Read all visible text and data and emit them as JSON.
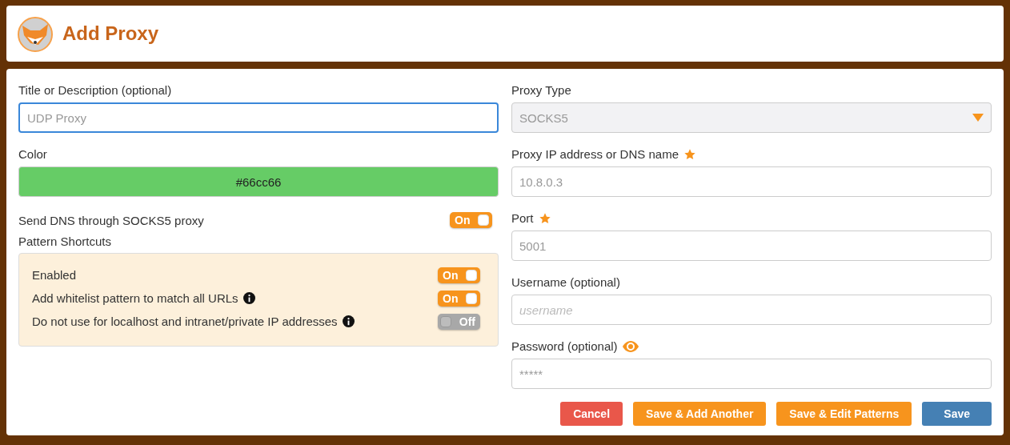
{
  "header": {
    "title": "Add Proxy"
  },
  "left": {
    "title_field": {
      "label": "Title or Description (optional)",
      "placeholder": "UDP Proxy",
      "focused": true
    },
    "color_field": {
      "label": "Color",
      "value": "#66cc66",
      "color": "#66cc66"
    },
    "dns_toggle": {
      "label": "Send DNS through SOCKS5 proxy",
      "on": true,
      "text": "On"
    },
    "pattern_shortcuts": {
      "label": "Pattern Shortcuts",
      "items": [
        {
          "label": "Enabled",
          "info": false,
          "on": true,
          "text": "On"
        },
        {
          "label": "Add whitelist pattern to match all URLs",
          "info": true,
          "on": true,
          "text": "On"
        },
        {
          "label": "Do not use for localhost and intranet/private IP addresses",
          "info": true,
          "on": false,
          "text": "Off"
        }
      ]
    }
  },
  "right": {
    "fields": [
      {
        "kind": "select",
        "label": "Proxy Type",
        "value": "SOCKS5"
      },
      {
        "kind": "input",
        "label": "Proxy IP address or DNS name",
        "required": true,
        "placeholder": "10.8.0.3"
      },
      {
        "kind": "input",
        "label": "Port",
        "required": true,
        "placeholder": "5001"
      },
      {
        "kind": "input",
        "label": "Username (optional)",
        "placeholder": "username",
        "italic": true
      },
      {
        "kind": "password",
        "label": "Password (optional)",
        "placeholder": "*****"
      }
    ]
  },
  "buttons": [
    {
      "label": "Cancel",
      "kind": "danger"
    },
    {
      "label": "Save & Add Another",
      "kind": "warning"
    },
    {
      "label": "Save & Edit Patterns",
      "kind": "warning"
    },
    {
      "label": "Save",
      "kind": "primary"
    }
  ]
}
